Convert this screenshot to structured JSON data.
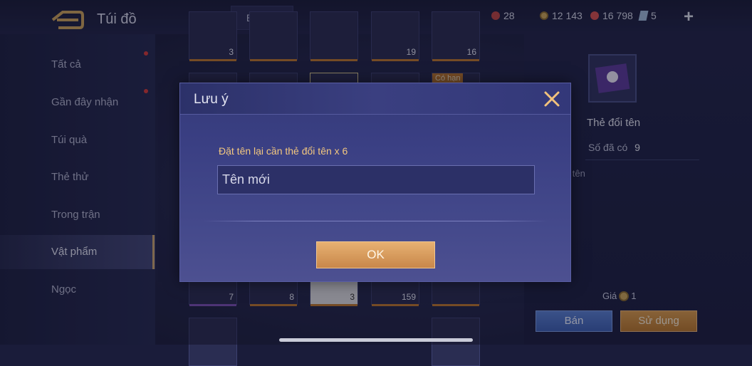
{
  "header": {
    "title": "Túi đồ",
    "sell_all": "Bán tất",
    "currencies": [
      {
        "value": "28",
        "icon": "red-gem-icon",
        "color": "#c74a4a"
      },
      {
        "value": "12 143",
        "icon": "gold-coin-icon",
        "color": "#c9a35a"
      },
      {
        "value": "16 798",
        "icon": "ruby-icon",
        "color": "#d05050"
      },
      {
        "value": "5",
        "icon": "voucher-icon",
        "color": "#9fb8d8"
      }
    ],
    "add_icon": "plus-icon"
  },
  "sidebar": {
    "items": [
      {
        "label": "Tất cả"
      },
      {
        "label": "Gần đây nhận"
      },
      {
        "label": "Túi quà"
      },
      {
        "label": "Thẻ thử"
      },
      {
        "label": "Trong trận"
      },
      {
        "label": "Vật phẩm"
      },
      {
        "label": "Ngọc"
      }
    ]
  },
  "grid": {
    "top_row_counts": [
      "3",
      "",
      "",
      "19",
      "16"
    ],
    "bottom_row_counts": [
      "7",
      "8",
      "3",
      "159",
      ""
    ],
    "tag": "Có hạn"
  },
  "detail": {
    "item_name": "Thẻ đổi tên",
    "owned_label": "Số đã có",
    "owned_value": "9",
    "desc_fragment": "ổi tên",
    "price_label": "Giá",
    "price_value": "1",
    "sell_button": "Bán",
    "use_button": "Sử dụng"
  },
  "modal": {
    "title": "Lưu ý",
    "prompt": "Đặt tên lại cần thẻ đổi tên x 6",
    "input_value": "Tên mới",
    "ok_label": "OK",
    "close_icon": "close-icon"
  }
}
